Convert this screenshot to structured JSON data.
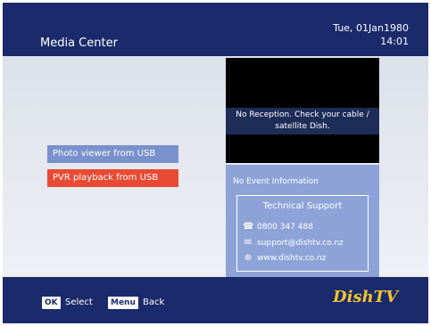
{
  "header": {
    "title": "Media Center",
    "date": "Tue, 01Jan1980",
    "time": "14:01"
  },
  "menu": {
    "items": [
      {
        "label": "Photo viewer from USB"
      },
      {
        "label": "PVR playback from USB"
      }
    ]
  },
  "preview": {
    "message": "No Reception. Check your cable / satellite Dish."
  },
  "info": {
    "event": "No Event Information",
    "support_title": "Technical Support",
    "phone": "0800 347 488",
    "email": "support@dishtv.co.nz",
    "web": "www.dishtv.co.nz"
  },
  "footer": {
    "ok_key": "OK",
    "ok_label": "Select",
    "menu_key": "Menu",
    "menu_label": "Back"
  },
  "logo": {
    "text": "DishTV"
  },
  "colors": {
    "header_bg": "#1b2a6b",
    "photo_item": "#7991cc",
    "pvr_item_selected": "#e94a33",
    "info_panel": "#8da3d8",
    "logo": "#f2c230"
  }
}
